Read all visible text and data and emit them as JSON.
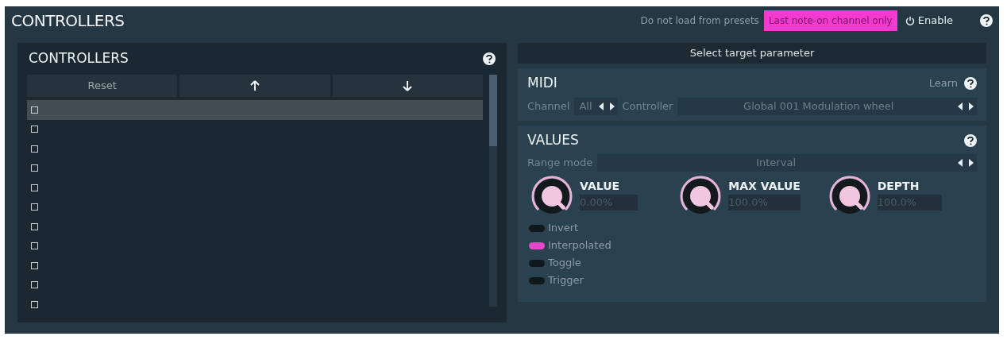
{
  "title": "CONTROLLERS",
  "header_options": [
    {
      "label": "Do not load from presets",
      "on": false
    },
    {
      "label": "Last note-on channel only",
      "on": true
    }
  ],
  "enable": {
    "label": "Enable",
    "on": true
  },
  "controllers_panel": {
    "title": "CONTROLLERS",
    "buttons": [
      {
        "kind": "text",
        "label": "Reset"
      },
      {
        "kind": "up"
      },
      {
        "kind": "down"
      }
    ],
    "rows": [
      {
        "selected": true,
        "checked": false
      },
      {
        "selected": false,
        "checked": false
      },
      {
        "selected": false,
        "checked": false
      },
      {
        "selected": false,
        "checked": false
      },
      {
        "selected": false,
        "checked": false
      },
      {
        "selected": false,
        "checked": false
      },
      {
        "selected": false,
        "checked": false
      },
      {
        "selected": false,
        "checked": false
      },
      {
        "selected": false,
        "checked": false
      },
      {
        "selected": false,
        "checked": false
      },
      {
        "selected": false,
        "checked": false
      }
    ]
  },
  "target_button": "Select target parameter",
  "midi": {
    "title": "MIDI",
    "learn": "Learn",
    "channel_label": "Channel",
    "channel_value": "All",
    "controller_label": "Controller",
    "controller_value": "Global 001 Modulation wheel"
  },
  "values": {
    "title": "VALUES",
    "range_label": "Range mode",
    "range_value": "Interval",
    "knobs": [
      {
        "label": "VALUE",
        "reading": "0.00%"
      },
      {
        "label": "MAX VALUE",
        "reading": "100.0%"
      },
      {
        "label": "DEPTH",
        "reading": "100.0%"
      }
    ],
    "toggles": [
      {
        "label": "Invert",
        "on": false
      },
      {
        "label": "Interpolated",
        "on": true
      },
      {
        "label": "Toggle",
        "on": false
      },
      {
        "label": "Trigger",
        "on": false
      }
    ]
  }
}
